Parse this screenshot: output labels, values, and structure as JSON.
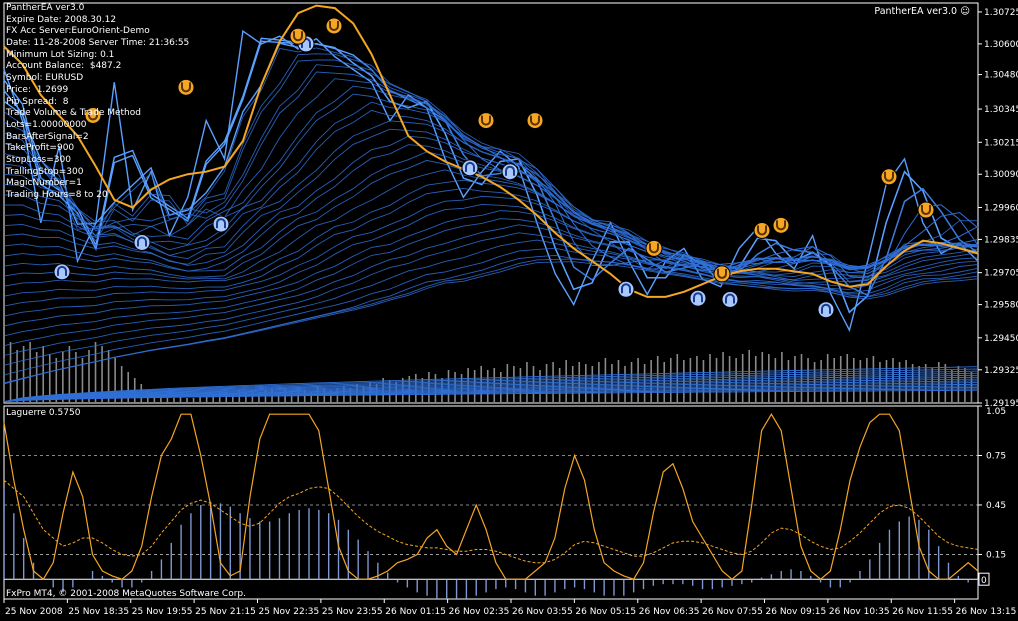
{
  "ea_title": "PantherEA ver3.0",
  "info_lines": [
    "PantherEA ver3.0",
    "Expire Date: 2008.30.12",
    "FX Acc Server:EuroOrient-Demo",
    "Date: 11-28-2008 Server Time: 21:36:55",
    "Minimum Lot Sizing: 0.1",
    "Account Balance:  $487.2",
    "Symbol: EURUSD",
    "Price:  1.2699",
    "Pip Spread:  8",
    "Trade Volume & Trade Method",
    "Lots=1.00000000",
    "BarsAfterSignal=2",
    "TakeProfit=900",
    "StopLoss=300",
    "TrallingStop=300",
    "MagicNumber=1",
    "Trading Hours=8 to 20"
  ],
  "indicator_label": "Laguerre 0.5750",
  "footer": "FxPro MT4, © 2001-2008 MetaQuotes Software Corp.",
  "colors": {
    "background": "#000000",
    "ribbon": "#2f6fd6",
    "ribbon_bright": "#5aa0ff",
    "ma": "#f5a623",
    "laguerre": "#f5a623",
    "grid": "#ffffff"
  },
  "chart_data": [
    {
      "type": "line",
      "symbol": "EURUSD",
      "x_ticks": [
        "25 Nov 2008",
        "25 Nov 18:35",
        "25 Nov 19:55",
        "25 Nov 21:15",
        "25 Nov 22:35",
        "25 Nov 23:55",
        "26 Nov 01:15",
        "26 Nov 02:35",
        "26 Nov 03:55",
        "26 Nov 05:15",
        "26 Nov 06:35",
        "26 Nov 07:55",
        "26 Nov 09:15",
        "26 Nov 10:35",
        "26 Nov 11:55",
        "26 Nov 13:15"
      ],
      "y_ticks": [
        1.30725,
        1.306,
        1.3048,
        1.30345,
        1.30215,
        1.3009,
        1.2996,
        1.29835,
        1.29705,
        1.2958,
        1.2945,
        1.29325,
        1.29195
      ],
      "ylim": [
        1.29195,
        1.3076
      ],
      "series": [
        {
          "values": [
            1.3059,
            1.3052,
            1.304,
            1.3032,
            1.3024,
            1.3012,
            1.2999,
            1.2996,
            1.3003,
            1.3007,
            1.3009,
            1.301,
            1.3012,
            1.3022,
            1.3044,
            1.3061,
            1.3072,
            1.3075,
            1.3074,
            1.3068,
            1.3056,
            1.304,
            1.3024,
            1.3018,
            1.3014,
            1.3011,
            1.3008,
            1.3004,
            1.2999,
            1.2993,
            1.2986,
            1.298,
            1.2975,
            1.297,
            1.2964,
            1.2961,
            1.2961,
            1.2963,
            1.2966,
            1.2969,
            1.2971,
            1.2972,
            1.2972,
            1.2971,
            1.297,
            1.2967,
            1.2965,
            1.2966,
            1.2973,
            1.2979,
            1.2983,
            1.2982,
            1.298,
            1.2978
          ]
        },
        {
          "values": [
            1.305,
            1.303,
            1.299,
            1.302,
            1.2975,
            1.299,
            1.3045,
            1.2995,
            1.301,
            1.2985,
            1.3,
            1.303,
            1.3015,
            1.3065,
            1.306,
            1.3063,
            1.3058,
            1.3062,
            1.3055,
            1.305,
            1.3045,
            1.303,
            1.304,
            1.3035,
            1.3015,
            1.3,
            1.301,
            1.3018,
            1.3012,
            1.299,
            1.297,
            1.2958,
            1.2975,
            1.299,
            1.2975,
            1.2962,
            1.2975,
            1.298,
            1.2968,
            1.2965,
            1.298,
            1.2988,
            1.2978,
            1.2972,
            1.2985,
            1.2962,
            1.2948,
            1.2975,
            1.3005,
            1.3015,
            1.299,
            1.2978,
            1.2982,
            1.2975
          ]
        }
      ],
      "ribbon_count": 34,
      "volume": [
        22,
        30,
        26,
        28,
        30,
        25,
        28,
        24,
        22,
        25,
        28,
        25,
        22,
        26,
        30,
        28,
        26,
        22,
        18,
        15,
        12,
        9,
        6,
        4,
        3,
        2,
        2,
        3,
        2,
        2,
        3,
        3,
        4,
        5,
        5,
        4,
        6,
        5,
        6,
        5,
        6,
        7,
        5,
        7,
        6,
        7,
        6,
        5,
        8,
        7,
        6,
        7,
        8,
        7,
        9,
        8,
        10,
        9,
        12,
        11,
        10,
        12,
        13,
        14,
        12,
        15,
        14,
        12,
        16,
        15,
        14,
        17,
        16,
        18,
        16,
        17,
        15,
        19,
        18,
        17,
        20,
        18,
        16,
        19,
        20,
        17,
        21,
        18,
        20,
        19,
        18,
        20,
        22,
        19,
        21,
        18,
        20,
        22,
        19,
        21,
        23,
        20,
        22,
        24,
        21,
        22,
        23,
        21,
        24,
        22,
        25,
        23,
        22,
        24,
        26,
        23,
        25,
        24,
        22,
        25,
        21,
        23,
        24,
        22,
        20,
        21,
        24,
        22,
        23,
        24,
        22,
        21,
        22,
        23,
        20,
        21,
        22,
        20,
        21,
        19,
        18,
        19,
        17,
        20,
        19,
        16,
        18,
        17,
        15,
        16
      ],
      "signals": [
        {
          "kind": "buy",
          "value": 1.29708
        },
        {
          "kind": "buy",
          "value": 1.29823
        },
        {
          "kind": "buy",
          "value": 1.29895
        },
        {
          "kind": "buy",
          "value": 1.306
        },
        {
          "kind": "buy",
          "value": 1.30115
        },
        {
          "kind": "buy",
          "value": 1.301
        },
        {
          "kind": "buy",
          "value": 1.2964
        },
        {
          "kind": "buy",
          "value": 1.29605
        },
        {
          "kind": "buy",
          "value": 1.296
        },
        {
          "kind": "buy",
          "value": 1.2956
        },
        {
          "kind": "sell",
          "value": 1.3032
        },
        {
          "kind": "sell",
          "value": 1.3043
        },
        {
          "kind": "sell",
          "value": 1.3063
        },
        {
          "kind": "sell",
          "value": 1.3067
        },
        {
          "kind": "sell",
          "value": 1.303
        },
        {
          "kind": "sell",
          "value": 1.303
        },
        {
          "kind": "sell",
          "value": 1.298
        },
        {
          "kind": "sell",
          "value": 1.297
        },
        {
          "kind": "sell",
          "value": 1.2987
        },
        {
          "kind": "sell",
          "value": 1.2989
        },
        {
          "kind": "sell",
          "value": 1.3008
        },
        {
          "kind": "sell",
          "value": 1.2995
        }
      ]
    },
    {
      "type": "line",
      "title": "Laguerre 0.5750",
      "y_ticks": [
        1.05,
        0.75,
        0.45,
        0.15
      ],
      "ylim": [
        -0.12,
        1.05
      ],
      "levels": [
        0.75,
        0.45,
        0.15
      ],
      "zero_label": "0",
      "series": [
        {
          "values": [
            0.95,
            0.6,
            0.3,
            0.05,
            0.0,
            0.1,
            0.4,
            0.65,
            0.5,
            0.15,
            0.05,
            0.02,
            0.0,
            0.05,
            0.2,
            0.5,
            0.75,
            0.85,
            1.0,
            1.0,
            0.75,
            0.45,
            0.1,
            0.02,
            0.05,
            0.5,
            0.85,
            1.0,
            1.0,
            1.0,
            1.0,
            1.0,
            0.9,
            0.55,
            0.2,
            0.05,
            0.0,
            0.0,
            0.02,
            0.05,
            0.1,
            0.12,
            0.15,
            0.25,
            0.3,
            0.2,
            0.15,
            0.3,
            0.45,
            0.3,
            0.1,
            0.0,
            0.0,
            0.0,
            0.05,
            0.1,
            0.25,
            0.55,
            0.75,
            0.6,
            0.3,
            0.1,
            0.05,
            0.02,
            0.0,
            0.1,
            0.4,
            0.65,
            0.7,
            0.55,
            0.35,
            0.25,
            0.15,
            0.05,
            0.0,
            0.05,
            0.45,
            0.9,
            1.0,
            0.9,
            0.55,
            0.2,
            0.05,
            0.0,
            0.05,
            0.3,
            0.6,
            0.8,
            0.95,
            1.0,
            1.0,
            0.9,
            0.55,
            0.2,
            0.05,
            0.0,
            0.0,
            0.05,
            0.1,
            0.05
          ]
        },
        {
          "values": [
            0.6,
            0.55,
            0.5,
            0.4,
            0.3,
            0.25,
            0.2,
            0.22,
            0.25,
            0.25,
            0.22,
            0.18,
            0.15,
            0.14,
            0.15,
            0.2,
            0.28,
            0.35,
            0.42,
            0.46,
            0.48,
            0.46,
            0.42,
            0.38,
            0.34,
            0.32,
            0.34,
            0.4,
            0.46,
            0.5,
            0.52,
            0.55,
            0.56,
            0.55,
            0.5,
            0.44,
            0.38,
            0.33,
            0.29,
            0.26,
            0.23,
            0.21,
            0.2,
            0.19,
            0.19,
            0.18,
            0.17,
            0.17,
            0.18,
            0.18,
            0.17,
            0.15,
            0.13,
            0.11,
            0.1,
            0.1,
            0.12,
            0.16,
            0.21,
            0.23,
            0.22,
            0.2,
            0.18,
            0.16,
            0.14,
            0.14,
            0.16,
            0.19,
            0.22,
            0.23,
            0.23,
            0.22,
            0.2,
            0.18,
            0.16,
            0.15,
            0.17,
            0.22,
            0.28,
            0.31,
            0.3,
            0.27,
            0.23,
            0.2,
            0.18,
            0.19,
            0.23,
            0.28,
            0.34,
            0.4,
            0.44,
            0.45,
            0.43,
            0.38,
            0.32,
            0.26,
            0.22,
            0.2,
            0.19,
            0.18
          ]
        }
      ],
      "histogram": [
        0.55,
        0.4,
        0.25,
        0.1,
        0.0,
        -0.05,
        -0.08,
        -0.05,
        0.0,
        0.05,
        0.02,
        -0.02,
        -0.05,
        -0.05,
        -0.02,
        0.05,
        0.12,
        0.22,
        0.33,
        0.4,
        0.45,
        0.47,
        0.46,
        0.44,
        0.4,
        0.37,
        0.35,
        0.35,
        0.37,
        0.4,
        0.42,
        0.43,
        0.42,
        0.4,
        0.36,
        0.3,
        0.24,
        0.17,
        0.1,
        0.04,
        -0.02,
        -0.05,
        -0.08,
        -0.1,
        -0.12,
        -0.12,
        -0.12,
        -0.12,
        -0.1,
        -0.08,
        -0.06,
        -0.05,
        -0.06,
        -0.08,
        -0.1,
        -0.1,
        -0.08,
        -0.06,
        -0.05,
        -0.06,
        -0.08,
        -0.1,
        -0.1,
        -0.1,
        -0.08,
        -0.06,
        -0.04,
        -0.03,
        -0.03,
        -0.03,
        -0.04,
        -0.06,
        -0.06,
        -0.05,
        -0.04,
        -0.03,
        -0.02,
        0.01,
        0.03,
        0.05,
        0.06,
        0.05,
        0.02,
        -0.02,
        -0.05,
        -0.05,
        -0.02,
        0.05,
        0.12,
        0.22,
        0.3,
        0.35,
        0.38,
        0.36,
        0.3,
        0.2,
        0.1,
        0.02,
        -0.02,
        -0.04
      ]
    }
  ]
}
